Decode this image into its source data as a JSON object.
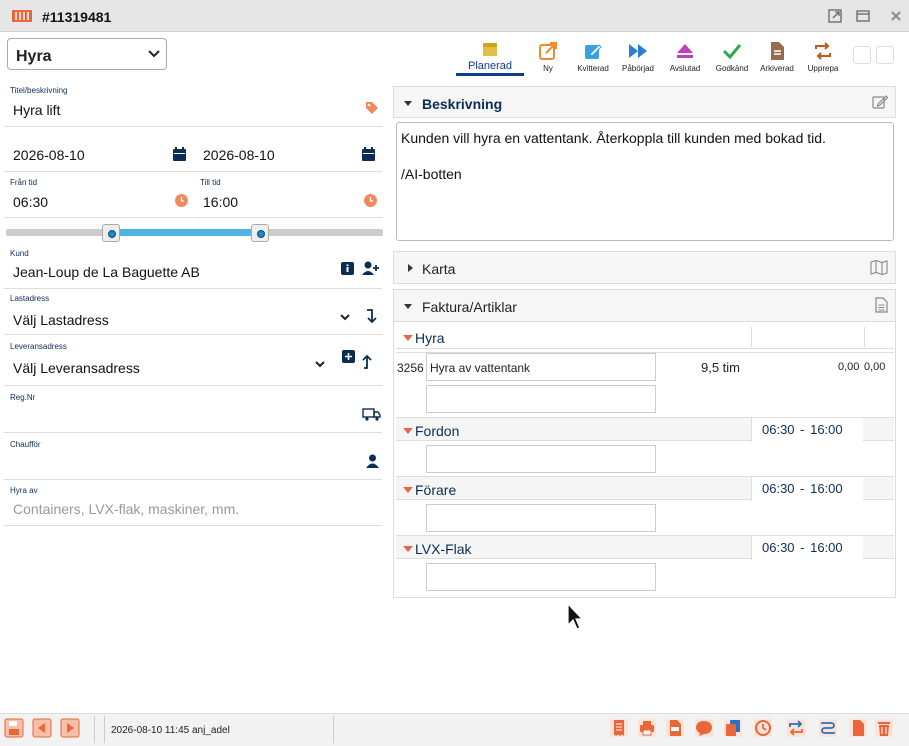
{
  "window": {
    "title": "#11319481"
  },
  "type_select": {
    "value": "Hyra"
  },
  "statuses": [
    {
      "label": "Planerad",
      "color": "#e0c040",
      "icon": "calendar-icon",
      "active": true
    },
    {
      "label": "Ny",
      "color": "#f08a30",
      "icon": "external-link-icon"
    },
    {
      "label": "Kvitterad",
      "color": "#3aa0e0",
      "icon": "edit-icon"
    },
    {
      "label": "Påbörjad",
      "color": "#2a80d0",
      "icon": "fast-forward-icon"
    },
    {
      "label": "Avslutad",
      "color": "#c040c0",
      "icon": "eject-icon"
    },
    {
      "label": "Godkänd",
      "color": "#2aaa4a",
      "icon": "check-icon"
    },
    {
      "label": "Arkiverad",
      "color": "#9a6a50",
      "icon": "file-icon"
    },
    {
      "label": "Upprepa",
      "color": "#c05a20",
      "icon": "repeat-icon"
    }
  ],
  "form": {
    "title_label": "Titel/beskrivning",
    "title_value": "Hyra lift",
    "date_from": "2026-08-10",
    "date_to": "2026-08-10",
    "from_time_label": "Från tid",
    "from_time": "06:30",
    "to_time_label": "Till tid",
    "to_time": "16:00",
    "customer_label": "Kund",
    "customer_value": "Jean-Loup de La Baguette AB",
    "load_address_label": "Lastadress",
    "load_address_value": "Välj Lastadress",
    "delivery_address_label": "Leveransadress",
    "delivery_address_value": "Välj Leveransadress",
    "reg_label": "Reg.Nr",
    "driver_label": "Chaufför",
    "rent_label": "Hyra av",
    "rent_placeholder": "Containers, LVX-flak, maskiner, mm."
  },
  "description": {
    "title": "Beskrivning",
    "line1": "Kunden vill hyra en vattentank. Återkoppla till kunden med bokad tid.",
    "line2": "/AI-botten"
  },
  "map": {
    "title": "Karta"
  },
  "invoice": {
    "title": "Faktura/Artiklar",
    "groups": [
      {
        "name": "Hyra"
      },
      {
        "name": "Fordon",
        "time": "06:30 -   16:00"
      },
      {
        "name": "Förare",
        "time": "06:30 -   16:00"
      },
      {
        "name": "LVX-Flak",
        "time": "06:30 -   16:00"
      }
    ],
    "row": {
      "code": "3256",
      "text": "Hyra av vattentank",
      "qty": "9,5 tim",
      "price": "0,00",
      "total": "0,00"
    }
  },
  "footer": {
    "info": "2026-08-10 11:45 anj_adel"
  },
  "colors": {
    "accent": "#0b3d91",
    "orange": "#f08a5d",
    "footer_icon": "#e8663a"
  }
}
